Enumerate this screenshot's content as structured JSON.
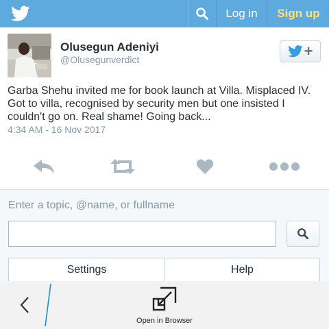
{
  "header": {
    "logo_icon": "twitter-bird-icon",
    "search_icon": "search-icon",
    "login_label": "Log in",
    "signup_label": "Sign up",
    "bar_color": "#5ea9dd",
    "signup_color": "#ffe17d"
  },
  "tweet": {
    "avatar_icon": "user-avatar",
    "name": "Olusegun Adeniyi",
    "handle": "@Olusegunverdict",
    "follow_icon": "follow-bird-plus-icon",
    "follow_plus": "+",
    "text": "Garba Shehu invited me for book launch at Villa. Misplaced IV. Got to villa, recognised by security men but one insisted I couldn't go on. Real shame! Going back...",
    "timestamp": "4:34 AM - 16 Nov 2017",
    "actions": [
      "reply-icon",
      "retweet-icon",
      "like-icon",
      "more-icon"
    ]
  },
  "search": {
    "prompt": "Enter a topic, @name, or fullname",
    "value": "",
    "placeholder": "",
    "button_icon": "search-icon"
  },
  "menu": {
    "settings_label": "Settings",
    "help_label": "Help"
  },
  "browser_bar": {
    "back_icon": "chevron-left-icon",
    "open_label": "Open in Browser",
    "open_icon": "open-in-browser-icon",
    "accent_color": "#1a8fd6"
  }
}
